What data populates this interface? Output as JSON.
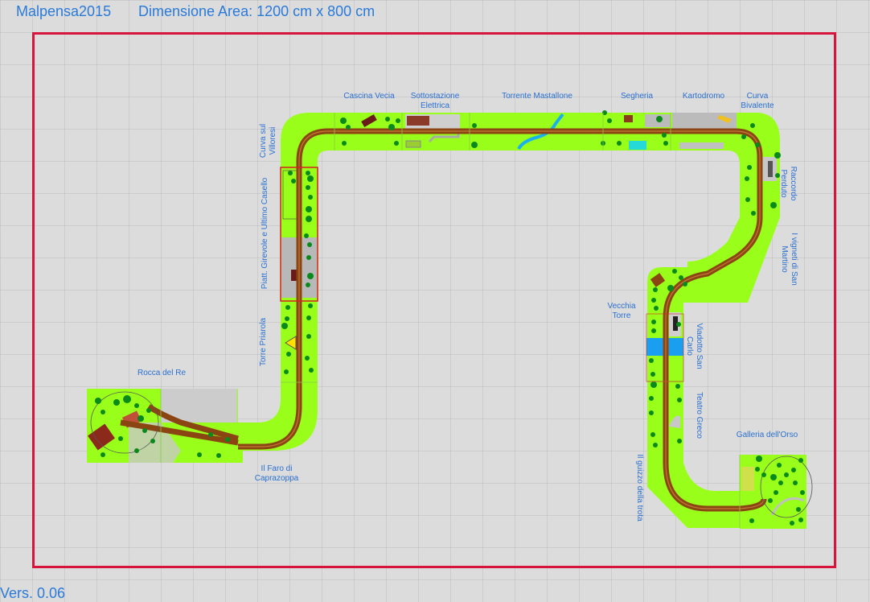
{
  "header": {
    "project_name": "Malpensa2015",
    "dimension_text": "Dimensione Area: 1200 cm x 800 cm"
  },
  "version": "Vers. 0.06",
  "colors": {
    "area_border": "#d6143c",
    "ground": "#99ff1a",
    "track": "#8b4513",
    "water": "#1aa0e8",
    "label": "#2a6fd1"
  },
  "labels": {
    "cascina_vecia": "Cascina Vecia",
    "sottostazione_1": "Sottostazione",
    "sottostazione_2": "Elettrica",
    "torrente": "Torrente Mastallone",
    "segheria": "Segheria",
    "kartodromo": "Kartodromo",
    "curva_bivalente_1": "Curva",
    "curva_bivalente_2": "Bivalente",
    "curva_villoresi_1": "Curva sul",
    "curva_villoresi_2": "Villoresi",
    "piattaforma": "Piatt. Girevole e Ultimo Casello",
    "torre_priarola": "Torre Priarola",
    "rocca_del_re": "Rocca del Re",
    "faro_1": "Il Faro di",
    "faro_2": "Caprazoppa",
    "raccordo_1": "Raccordo",
    "raccordo_2": "Perduto",
    "vigneti_1": "I vigneti di San",
    "vigneti_2": "Martino",
    "vecchia_torre_1": "Vecchia",
    "vecchia_torre_2": "Torre",
    "viadotto_1": "Viadotto San",
    "viadotto_2": "Carlo",
    "teatro_greco": "Teatro Greco",
    "galleria": "Galleria dell'Orso",
    "guizzo": "Il guizzo della trota"
  }
}
